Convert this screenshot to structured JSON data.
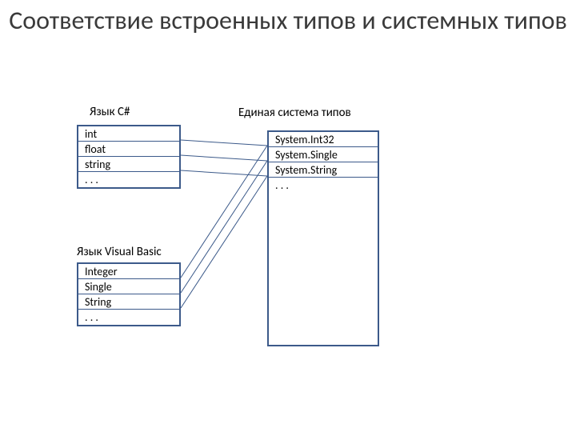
{
  "title": "Соответствие встроенных типов и системных типов",
  "labels": {
    "csharp": "Язык C#",
    "vb": "Язык Visual Basic",
    "cts": "Единая система типов"
  },
  "csharp": {
    "rows": [
      "int",
      "float",
      "string",
      ". . ."
    ]
  },
  "vb": {
    "rows": [
      "Integer",
      "Single",
      "String",
      ". . ."
    ]
  },
  "cts": {
    "rows": [
      "System.Int32",
      "System.Single",
      "System.String",
      ". . ."
    ]
  }
}
